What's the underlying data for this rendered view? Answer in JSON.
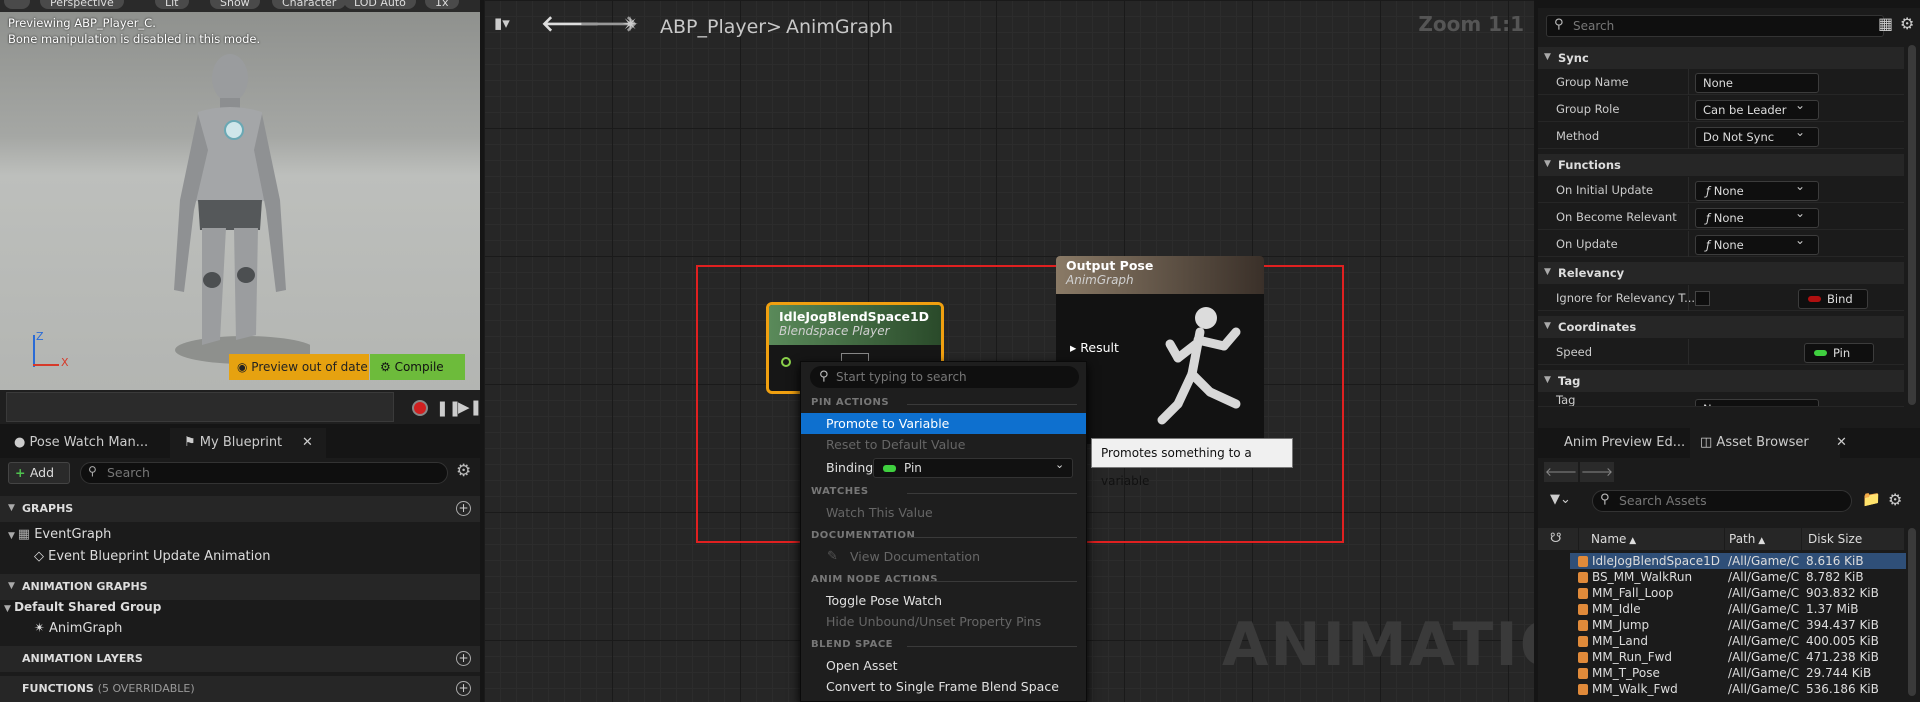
{
  "viewport": {
    "top_pills": [
      "Perspective",
      "Lit",
      "Show",
      "Character",
      "LOD Auto",
      "1x"
    ],
    "preview_title": "Previewing ABP_Player_C.",
    "preview_note": "Bone manipulation is disabled in this mode.",
    "axis_z": "Z",
    "axis_x": "X",
    "preview_warning": "Preview out of date",
    "compile_label": "Compile"
  },
  "left_panel": {
    "tabs": [
      "Pose Watch Man...",
      "My Blueprint"
    ],
    "add_label": "Add",
    "search_placeholder": "Search",
    "graphs_header": "GRAPHS",
    "event_graph": "EventGraph",
    "event_update": "Event Blueprint Update Animation",
    "anim_graphs_header": "ANIMATION GRAPHS",
    "default_group": "Default Shared Group",
    "anim_graph": "AnimGraph",
    "anim_layers_header": "ANIMATION LAYERS",
    "functions_header": "FUNCTIONS",
    "functions_count": "(5 OVERRIDABLE)"
  },
  "graph": {
    "breadcrumb_root": "ABP_Player",
    "breadcrumb_sep": ">",
    "breadcrumb_leaf": "AnimGraph",
    "zoom": "Zoom 1:1",
    "watermark": "ANIMATION",
    "node_blend": {
      "title": "IdleJogBlendSpace1D",
      "subtitle": "Blendspace Player"
    },
    "node_output": {
      "title": "Output Pose",
      "subtitle": "AnimGraph",
      "pin": "Result"
    }
  },
  "context_menu": {
    "search_placeholder": "Start typing to search",
    "sec_pin": "PIN ACTIONS",
    "promote": "Promote to Variable",
    "reset": "Reset to Default Value",
    "binding_label": "Binding",
    "binding_value": "Pin",
    "sec_watches": "WATCHES",
    "watch": "Watch This Value",
    "sec_doc": "DOCUMENTATION",
    "view_doc": "View Documentation",
    "sec_anim": "ANIM NODE ACTIONS",
    "toggle_pose": "Toggle Pose Watch",
    "hide_unbound": "Hide Unbound/Unset Property Pins",
    "sec_blend": "BLEND SPACE",
    "open_asset": "Open Asset",
    "convert": "Convert to Single Frame Blend Space Player"
  },
  "tooltip": "Promotes something to a variable",
  "details": {
    "search_placeholder": "Search",
    "sync": "Sync",
    "group_name_label": "Group Name",
    "group_name_value": "None",
    "group_role_label": "Group Role",
    "group_role_value": "Can be Leader",
    "method_label": "Method",
    "method_value": "Do Not Sync",
    "functions": "Functions",
    "on_initial_label": "On Initial Update",
    "on_become_label": "On Become Relevant",
    "on_update_label": "On Update",
    "func_value": "None",
    "relevancy": "Relevancy",
    "ignore_label": "Ignore for Relevancy T...",
    "bind_label": "Bind",
    "coordinates": "Coordinates",
    "speed_label": "Speed",
    "speed_value": "Pin",
    "tag": "Tag",
    "tag_label": "Tag",
    "tag_value": "None"
  },
  "asset_browser": {
    "tabs": [
      "Anim Preview Ed...",
      "Asset Browser"
    ],
    "search_placeholder": "Search Assets",
    "col_name": "Name",
    "col_path": "Path",
    "col_size": "Disk Size",
    "rows": [
      {
        "name": "IdleJogBlendSpace1D",
        "path": "/All/Game/C",
        "size": "8.616 KiB"
      },
      {
        "name": "BS_MM_WalkRun",
        "path": "/All/Game/C",
        "size": "8.782 KiB"
      },
      {
        "name": "MM_Fall_Loop",
        "path": "/All/Game/C",
        "size": "903.832 KiB"
      },
      {
        "name": "MM_Idle",
        "path": "/All/Game/C",
        "size": "1.37 MiB"
      },
      {
        "name": "MM_Jump",
        "path": "/All/Game/C",
        "size": "394.437 KiB"
      },
      {
        "name": "MM_Land",
        "path": "/All/Game/C",
        "size": "400.005 KiB"
      },
      {
        "name": "MM_Run_Fwd",
        "path": "/All/Game/C",
        "size": "471.238 KiB"
      },
      {
        "name": "MM_T_Pose",
        "path": "/All/Game/C",
        "size": "29.744 KiB"
      },
      {
        "name": "MM_Walk_Fwd",
        "path": "/All/Game/C",
        "size": "536.186 KiB"
      }
    ]
  }
}
